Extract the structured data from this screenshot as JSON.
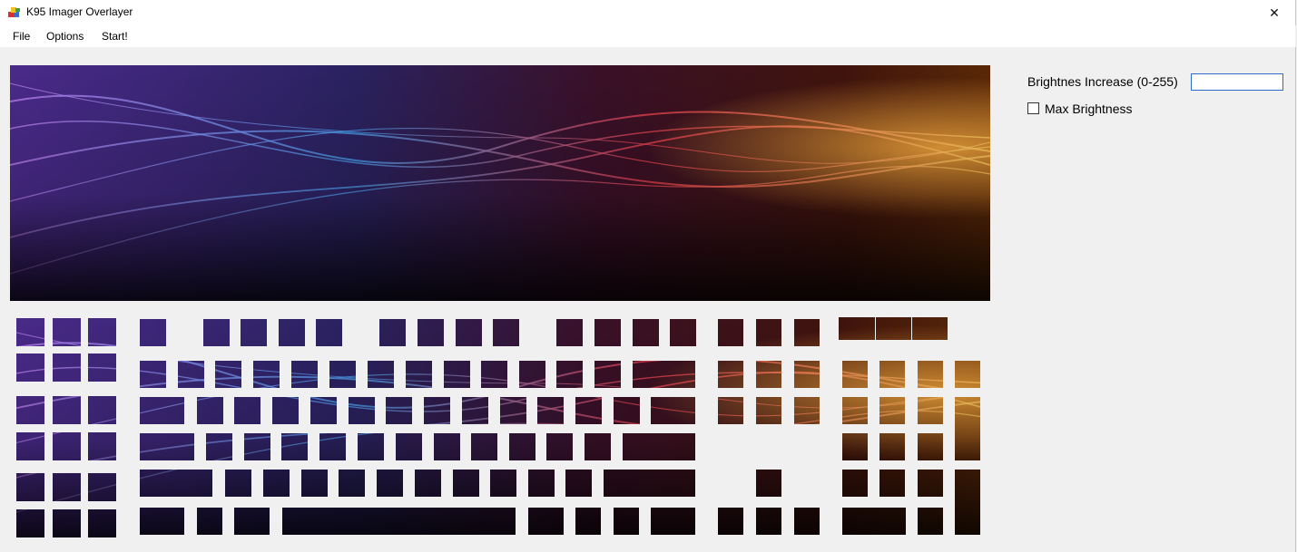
{
  "window": {
    "title": "K95 Imager Overlayer",
    "close_glyph": "✕"
  },
  "menu": [
    {
      "label": "File"
    },
    {
      "label": "Options"
    },
    {
      "label": "Start!"
    }
  ],
  "controls": {
    "brightness_label": "Brightnes Increase (0-255)",
    "brightness_value": "",
    "max_brightness_label": "Max Brightness",
    "max_brightness_checked": false
  },
  "icons": {
    "app": "app-icon",
    "close": "close-icon"
  },
  "colors": {
    "window_bg": "#f0f0f0",
    "titlebar_bg": "#ffffff",
    "input_border": "#2a6cc7",
    "image_dark": "#0a0610",
    "image_purple": "#5a3a9a",
    "image_blue": "#2f5fb0",
    "image_red": "#c0283c",
    "image_orange": "#f0a030"
  }
}
